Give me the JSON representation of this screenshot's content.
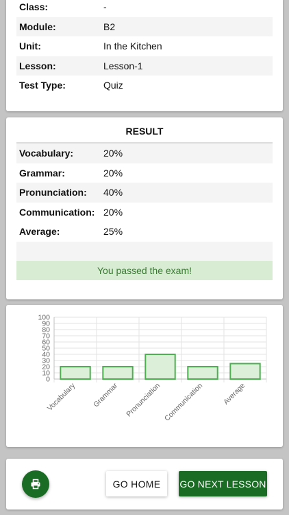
{
  "info": {
    "rows": [
      {
        "label": "Class:",
        "value": "-"
      },
      {
        "label": "Module:",
        "value": "B2"
      },
      {
        "label": "Unit:",
        "value": "In the Kitchen"
      },
      {
        "label": "Lesson:",
        "value": "Lesson-1"
      },
      {
        "label": "Test Type:",
        "value": "Quiz"
      }
    ]
  },
  "result": {
    "heading": "RESULT",
    "rows": [
      {
        "label": "Vocabulary:",
        "value": "20%"
      },
      {
        "label": "Grammar:",
        "value": "20%"
      },
      {
        "label": "Pronunciation:",
        "value": "40%"
      },
      {
        "label": "Communication:",
        "value": "20%"
      },
      {
        "label": "Average:",
        "value": "25%"
      }
    ],
    "status_message": "You passed the exam!"
  },
  "chart_data": {
    "type": "bar",
    "categories": [
      "Vocabulary",
      "Grammar",
      "Pronunciation",
      "Communication",
      "Average"
    ],
    "values": [
      20,
      20,
      40,
      20,
      25
    ],
    "ylim": [
      0,
      100
    ],
    "yticks": [
      0,
      10,
      20,
      30,
      40,
      50,
      60,
      70,
      80,
      90,
      100
    ],
    "grid": true,
    "bar_fill": "#dcefd8",
    "bar_stroke": "#4caf50"
  },
  "actions": {
    "print_icon": "print-icon",
    "home_label": "GO HOME",
    "next_label": "GO NEXT LESSON"
  },
  "colors": {
    "primary": "#1a6b24",
    "success_bg": "#d7ecd3",
    "success_text": "#3a7a32"
  }
}
